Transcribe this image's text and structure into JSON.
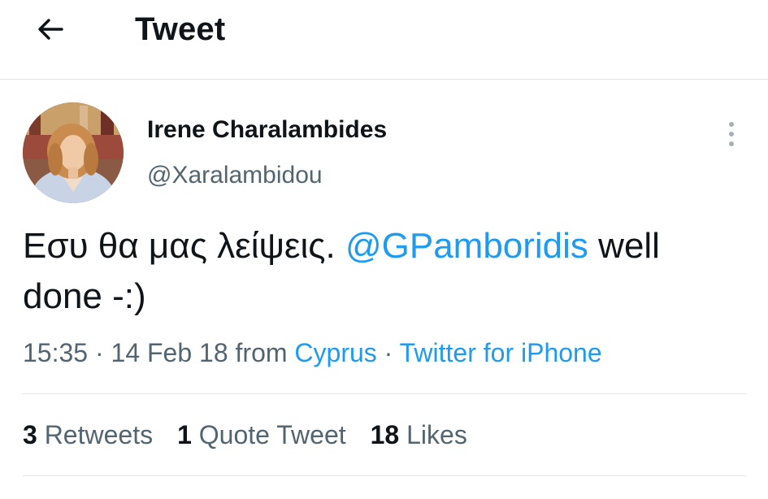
{
  "header": {
    "title": "Tweet",
    "back_icon": "arrow-left-icon"
  },
  "tweet": {
    "author_name": "Irene Charalambides",
    "author_handle": "@Xaralambidou",
    "text_before_mention": "Εσυ θα μας λείψεις. ",
    "mention": "@GPamboridis",
    "text_after_mention": " well done -:)",
    "time": "15:35",
    "date": "14 Feb 18",
    "separator": " · ",
    "from_label": "from",
    "location": "Cyprus",
    "client": "Twitter for iPhone"
  },
  "stats": {
    "retweets_count": "3",
    "retweets_label": "Retweets",
    "quotes_count": "1",
    "quotes_label": "Quote Tweet",
    "likes_count": "18",
    "likes_label": "Likes"
  },
  "colors": {
    "link": "#1d9bf0",
    "secondary_text": "#536471",
    "primary_text": "#0f1419",
    "divider": "#e1e5e8"
  }
}
